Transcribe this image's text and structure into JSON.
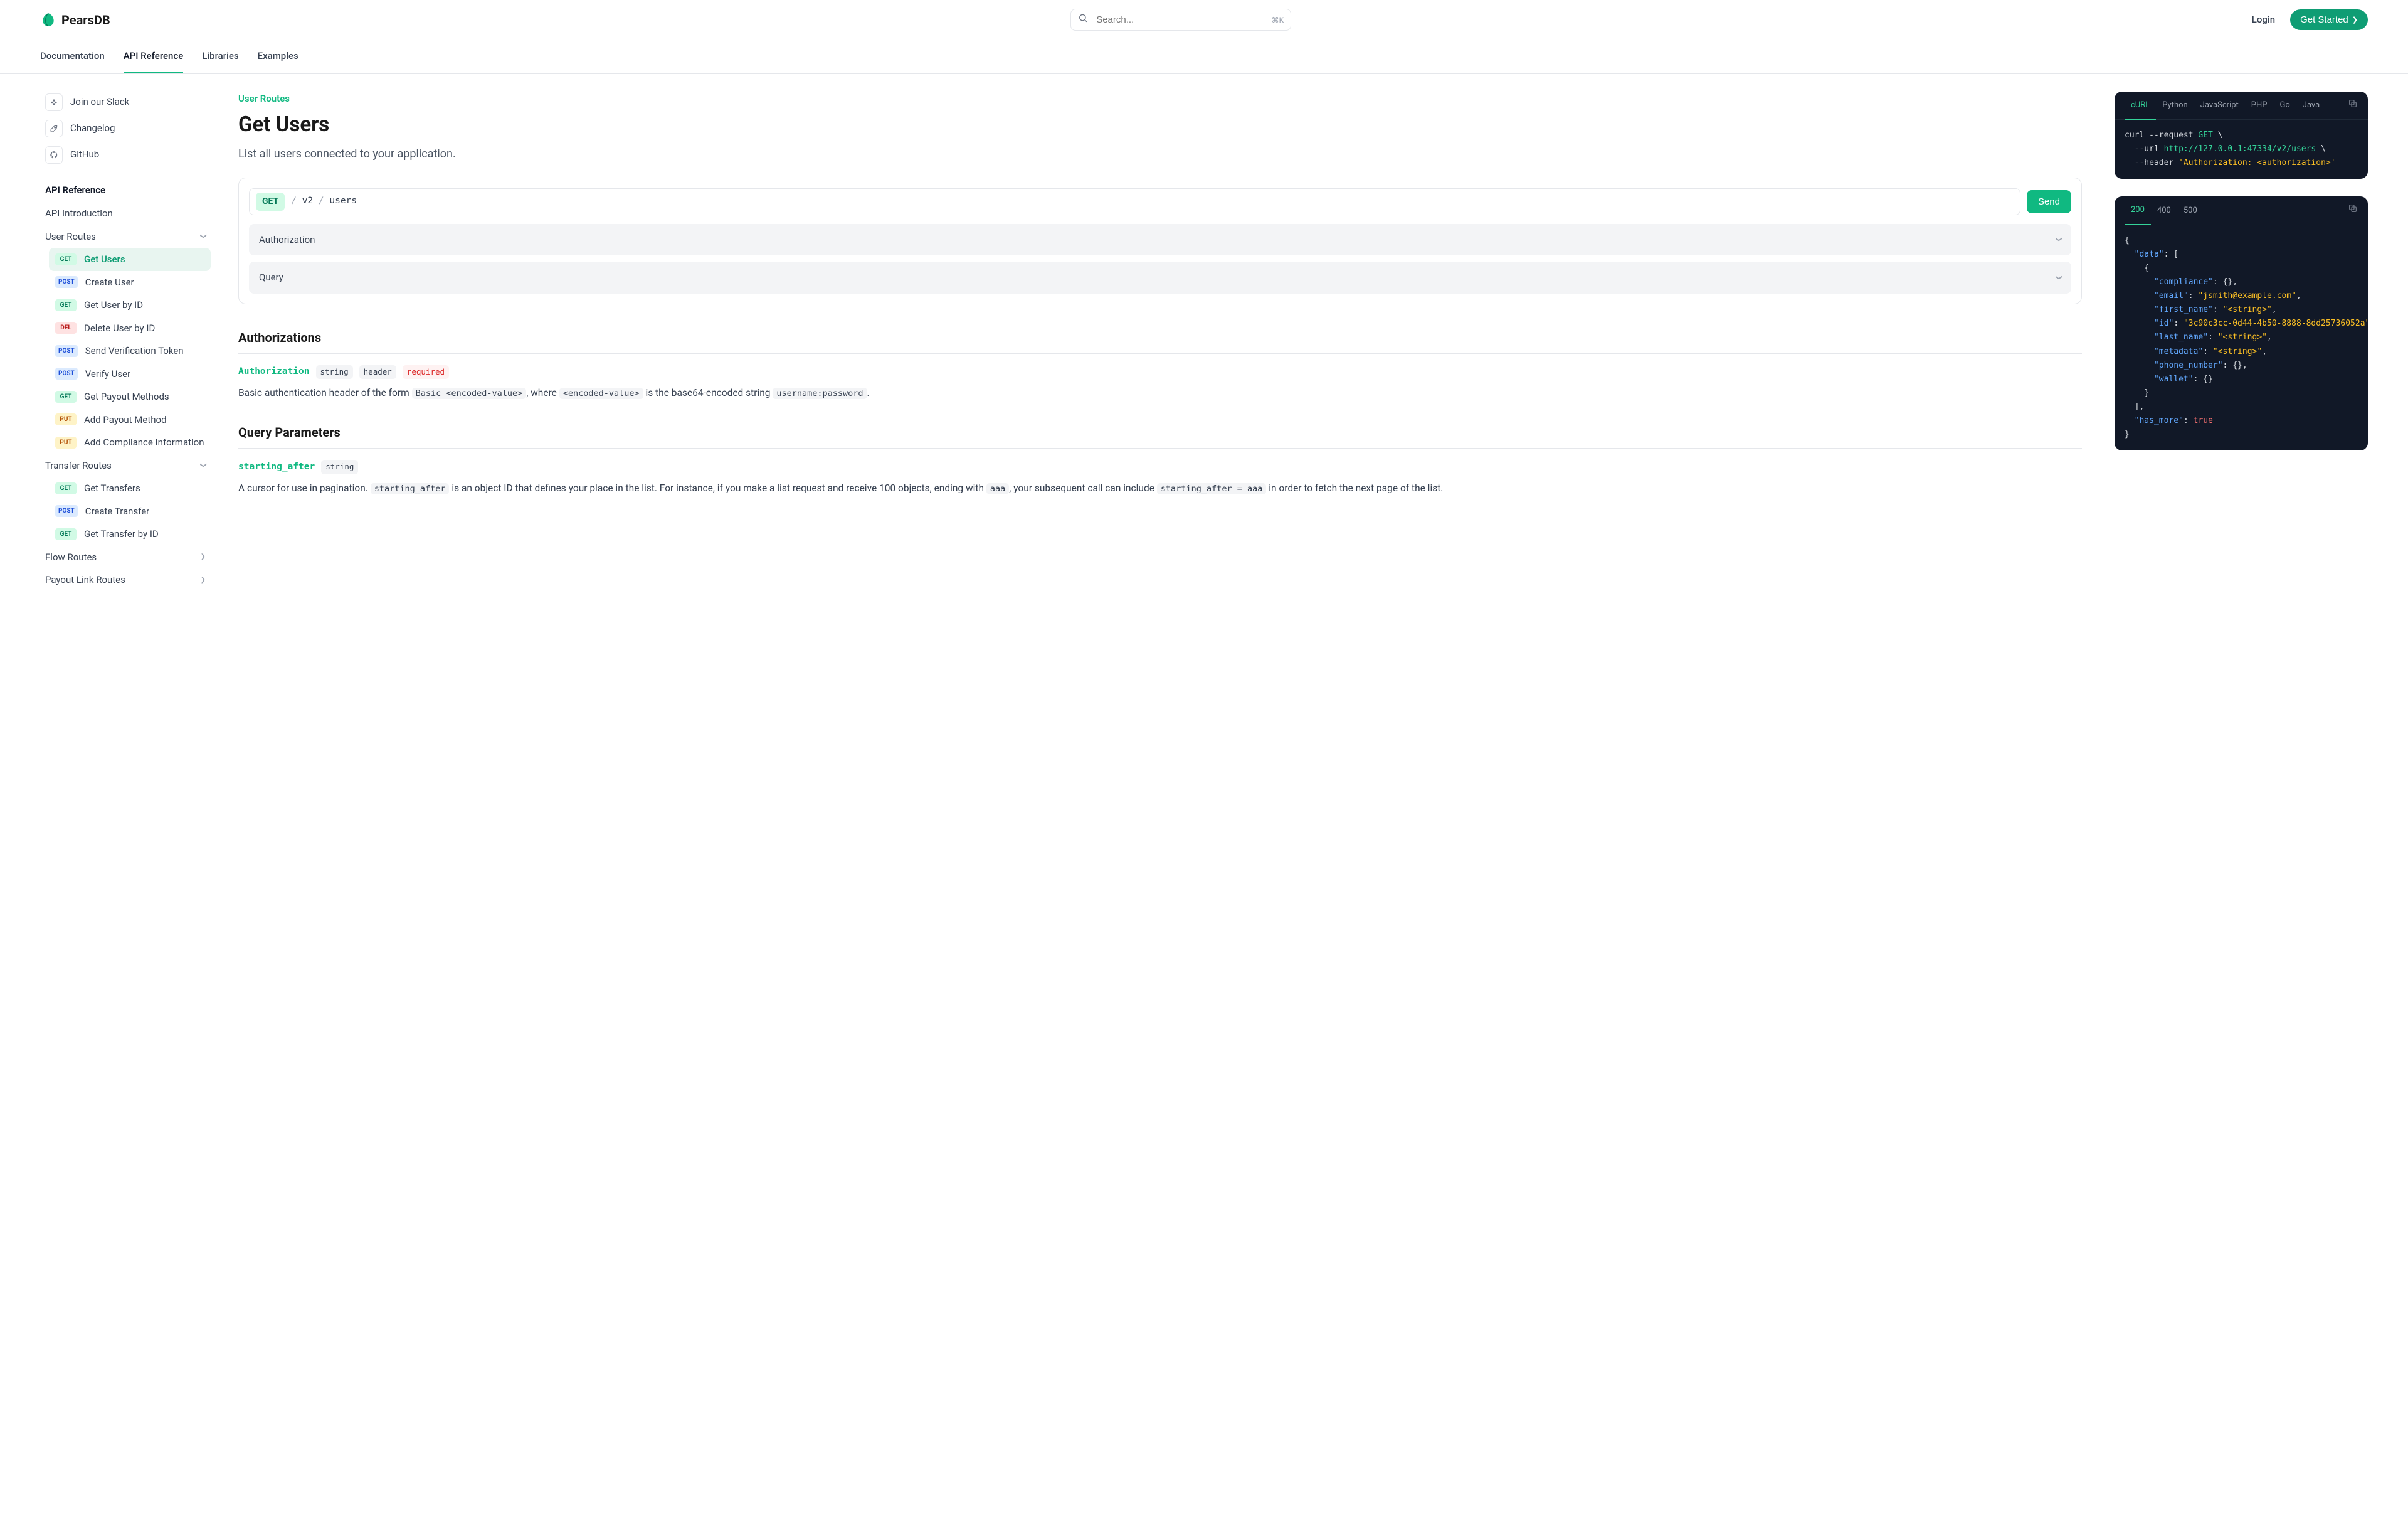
{
  "header": {
    "logo": "PearsDB",
    "search_placeholder": "Search...",
    "search_kbd": "⌘K",
    "login": "Login",
    "get_started": "Get Started"
  },
  "top_tabs": [
    "Documentation",
    "API Reference",
    "Libraries",
    "Examples"
  ],
  "sidebar": {
    "links": [
      "Join our Slack",
      "Changelog",
      "GitHub"
    ],
    "heading": "API Reference",
    "api_intro": "API Introduction",
    "sections": {
      "user_routes": "User Routes",
      "transfer_routes": "Transfer Routes",
      "flow_routes": "Flow Routes",
      "payout_link_routes": "Payout Link Routes"
    },
    "user_items": [
      {
        "method": "GET",
        "label": "Get Users"
      },
      {
        "method": "POST",
        "label": "Create User"
      },
      {
        "method": "GET",
        "label": "Get User by ID"
      },
      {
        "method": "DEL",
        "label": "Delete User by ID"
      },
      {
        "method": "POST",
        "label": "Send Verification Token"
      },
      {
        "method": "POST",
        "label": "Verify User"
      },
      {
        "method": "GET",
        "label": "Get Payout Methods"
      },
      {
        "method": "PUT",
        "label": "Add Payout Method"
      },
      {
        "method": "PUT",
        "label": "Add Compliance Information"
      }
    ],
    "transfer_items": [
      {
        "method": "GET",
        "label": "Get Transfers"
      },
      {
        "method": "POST",
        "label": "Create Transfer"
      },
      {
        "method": "GET",
        "label": "Get Transfer by ID"
      }
    ]
  },
  "page": {
    "kicker": "User Routes",
    "title": "Get Users",
    "desc": "List all users connected to your application.",
    "method": "GET",
    "path_parts": [
      "v2",
      "users"
    ],
    "send": "Send",
    "collapsibles": [
      "Authorization",
      "Query"
    ],
    "auth_heading": "Authorizations",
    "auth_param": {
      "name": "Authorization",
      "type": "string",
      "loc": "header",
      "req": "required",
      "desc_1": "Basic authentication header of the form ",
      "code_1": "Basic <encoded-value>",
      "desc_2": ", where ",
      "code_2": "<encoded-value>",
      "desc_3": " is the base64-encoded string ",
      "code_3": "username:password",
      "desc_4": "."
    },
    "query_heading": "Query Parameters",
    "query_param": {
      "name": "starting_after",
      "type": "string",
      "d1": "A cursor for use in pagination. ",
      "c1": "starting_after",
      "d2": " is an object ID that defines your place in the list. For instance, if you make a list request and receive 100 objects, ending with ",
      "c2": "aaa",
      "d3": ", your subsequent call can include ",
      "c3": "starting_after = aaa",
      "d4": " in order to fetch the next page of the list."
    }
  },
  "code1": {
    "tabs": [
      "cURL",
      "Python",
      "JavaScript",
      "PHP",
      "Go",
      "Java"
    ],
    "l1a": "curl --request ",
    "l1b": "GET",
    "l1c": " \\",
    "l2a": "  --url ",
    "l2b": "http://127.0.0.1:47334/v2/users",
    "l2c": " \\",
    "l3a": "  --header ",
    "l3b": "'Authorization: <authorization>'"
  },
  "code2": {
    "tabs": [
      "200",
      "400",
      "500"
    ]
  },
  "json_response": {
    "data_key": "\"data\"",
    "compliance": "\"compliance\"",
    "email_k": "\"email\"",
    "email_v": "\"jsmith@example.com\"",
    "first_name_k": "\"first_name\"",
    "first_name_v": "\"<string>\"",
    "id_k": "\"id\"",
    "id_v": "\"3c90c3cc-0d44-4b50-8888-8dd25736052a\"",
    "last_name_k": "\"last_name\"",
    "last_name_v": "\"<string>\"",
    "metadata_k": "\"metadata\"",
    "metadata_v": "\"<string>\"",
    "phone_k": "\"phone_number\"",
    "wallet_k": "\"wallet\"",
    "has_more_k": "\"has_more\"",
    "has_more_v": "true"
  }
}
